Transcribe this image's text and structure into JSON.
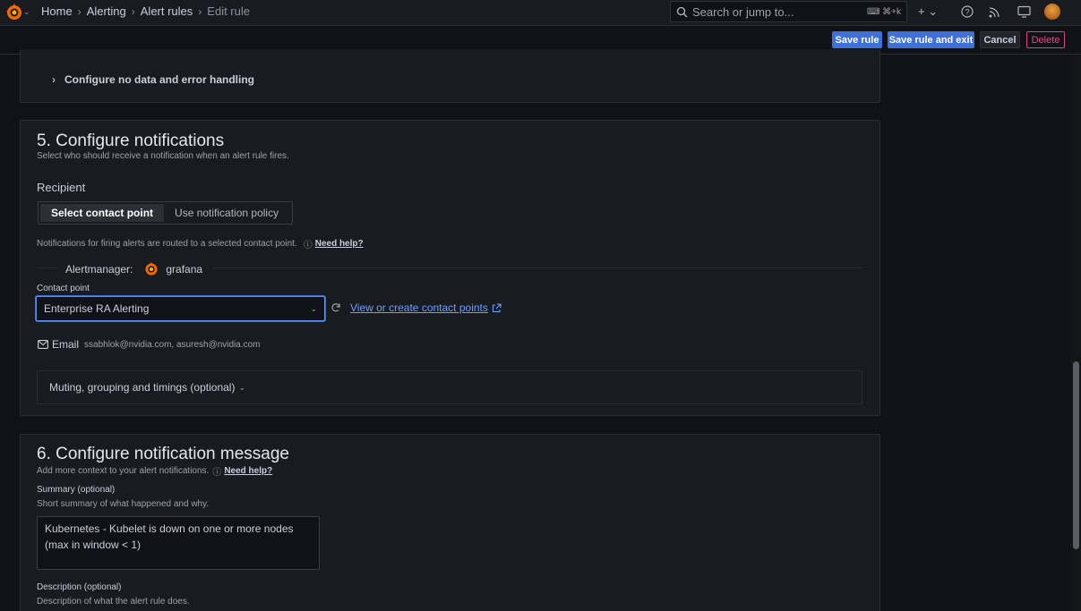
{
  "topbar": {
    "breadcrumb": [
      "Home",
      "Alerting",
      "Alert rules",
      "Edit rule"
    ],
    "search_placeholder": "Search or jump to...",
    "search_shortcut": "⌘+k"
  },
  "toolbar": {
    "save_label": "Save rule",
    "save_exit_label": "Save rule and exit",
    "cancel_label": "Cancel",
    "delete_label": "Delete"
  },
  "section4": {
    "collapse_label": "Configure no data and error handling"
  },
  "section5": {
    "title": "5. Configure notifications",
    "subtitle": "Select who should receive a notification when an alert rule fires.",
    "recipient_label": "Recipient",
    "tab_contact_point": "Select contact point",
    "tab_policy": "Use notification policy",
    "routing_text": "Notifications for firing alerts are routed to a selected contact point.",
    "need_help": "Need help?",
    "alertmanager_label": "Alertmanager:",
    "alertmanager_value": "grafana",
    "contact_point_label": "Contact point",
    "contact_point_value": "Enterprise RA Alerting",
    "view_create_link": "View or create contact points",
    "email_label": "Email",
    "email_value": "ssabhlok@nvidia.com, asuresh@nvidia.com",
    "muting_label": "Muting, grouping and timings (optional)"
  },
  "section6": {
    "title": "6. Configure notification message",
    "subtitle": "Add more context to your alert notifications.",
    "need_help": "Need help?",
    "summary_label": "Summary (optional)",
    "summary_hint": "Short summary of what happened and why.",
    "summary_value": "Kubernetes - Kubelet is down on one or more nodes (max in window < 1)",
    "description_label": "Description (optional)",
    "description_hint": "Description of what the alert rule does."
  },
  "colors": {
    "primary": "#3d71d9",
    "danger": "#e0478a",
    "link": "#6e9fff",
    "background": "#111217",
    "card": "#181b1f"
  }
}
